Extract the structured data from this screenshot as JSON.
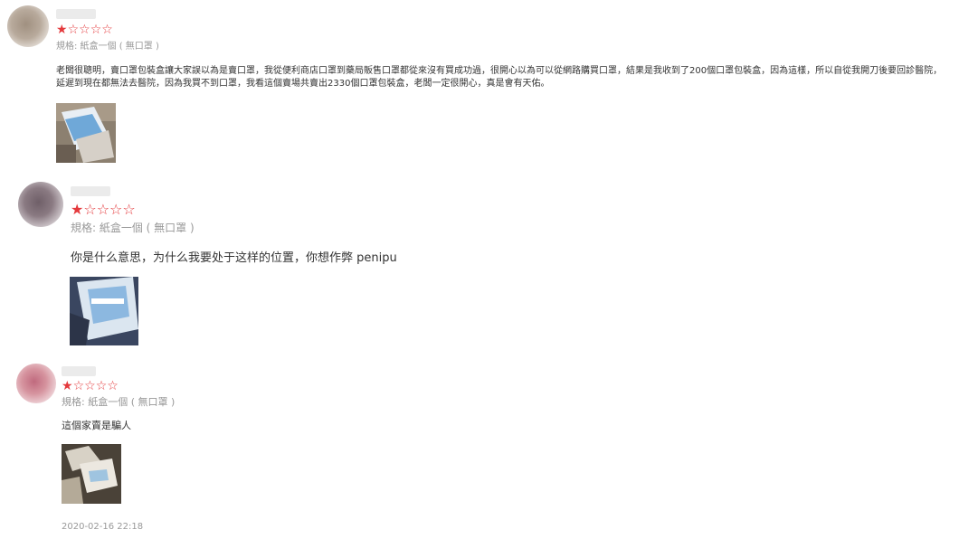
{
  "star_full": "★",
  "star_empty": "☆",
  "reviews": [
    {
      "rating": 1,
      "max_rating": 5,
      "spec": "規格: 紙盒一個 ( 無口罩 )",
      "content": "老闆很聰明，賣口罩包裝盒讓大家誤以為是賣口罩，我從便利商店口罩到藥局販售口罩都從來沒有買成功過，很開心以為可以從網路購買口罩，結果是我收到了200個口罩包裝盒，因為這樣，所以自從我開刀後要回診醫院，延遲到現在都無法去醫院，因為我買不到口罩，我看這個賣場共賣出2330個口罩包裝盒，老闆一定很開心，真是會有天佑。",
      "avatar_color": "#9a8a7a"
    },
    {
      "rating": 1,
      "max_rating": 5,
      "spec": "規格: 紙盒一個 ( 無口罩 )",
      "content": "你是什么意思，为什么我要处于这样的位置，你想作弊 penipu",
      "avatar_color": "#7a6a70"
    },
    {
      "rating": 1,
      "max_rating": 5,
      "spec": "規格: 紙盒一個 ( 無口罩 )",
      "content": "這個家賣是騙人",
      "avatar_color": "#c07a88"
    }
  ],
  "timestamp": "2020-02-16 22:18"
}
